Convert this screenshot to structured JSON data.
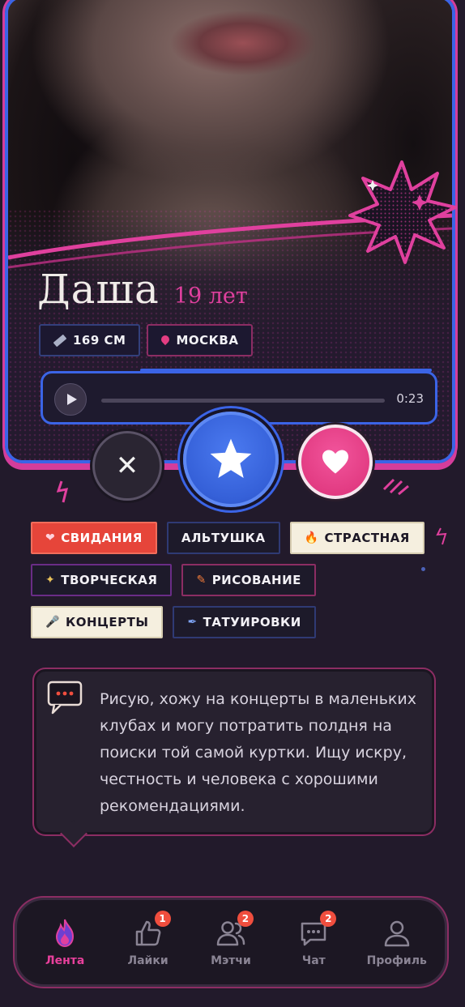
{
  "profile": {
    "name": "Даша",
    "age": "19 лет",
    "height": "169 СМ",
    "city": "МОСКВА"
  },
  "audio": {
    "duration": "0:23",
    "progress": 0
  },
  "actions": {
    "dislike_icon": "close-icon",
    "superlike_icon": "star-icon",
    "like_icon": "heart-icon"
  },
  "tags": [
    {
      "label": "СВИДАНИЯ",
      "icon": "heart",
      "style": "red"
    },
    {
      "label": "АЛЬТУШКА",
      "icon": "",
      "style": "blue"
    },
    {
      "label": "СТРАСТНАЯ",
      "icon": "fire",
      "style": "cream"
    },
    {
      "label": "ТВОРЧЕСКАЯ",
      "icon": "wand",
      "style": "purple"
    },
    {
      "label": "РИСОВАНИЕ",
      "icon": "pencil",
      "style": "magenta"
    },
    {
      "label": "КОНЦЕРТЫ",
      "icon": "microphone",
      "style": "cream"
    },
    {
      "label": "ТАТУИРОВКИ",
      "icon": "tattoo-pen",
      "style": "blue"
    }
  ],
  "about": {
    "text": "Рисую, хожу на концерты в маленьких клубах и могу потратить полдня на поиски той самой куртки. Ищу искру, честность и человека с хорошими рекомендациями."
  },
  "nav": {
    "items": [
      {
        "label": "Лента",
        "icon": "flame-icon",
        "active": true,
        "badge": ""
      },
      {
        "label": "Лайки",
        "icon": "thumbs-up-icon",
        "active": false,
        "badge": "1"
      },
      {
        "label": "Мэтчи",
        "icon": "users-icon",
        "active": false,
        "badge": "2"
      },
      {
        "label": "Чат",
        "icon": "chat-icon",
        "active": false,
        "badge": "2"
      },
      {
        "label": "Профиль",
        "icon": "user-icon",
        "active": false,
        "badge": ""
      }
    ]
  },
  "colors": {
    "background": "#221a2b",
    "accent_pink": "#e0409e",
    "accent_blue": "#3b64e6",
    "badge_red": "#f04e3e"
  }
}
